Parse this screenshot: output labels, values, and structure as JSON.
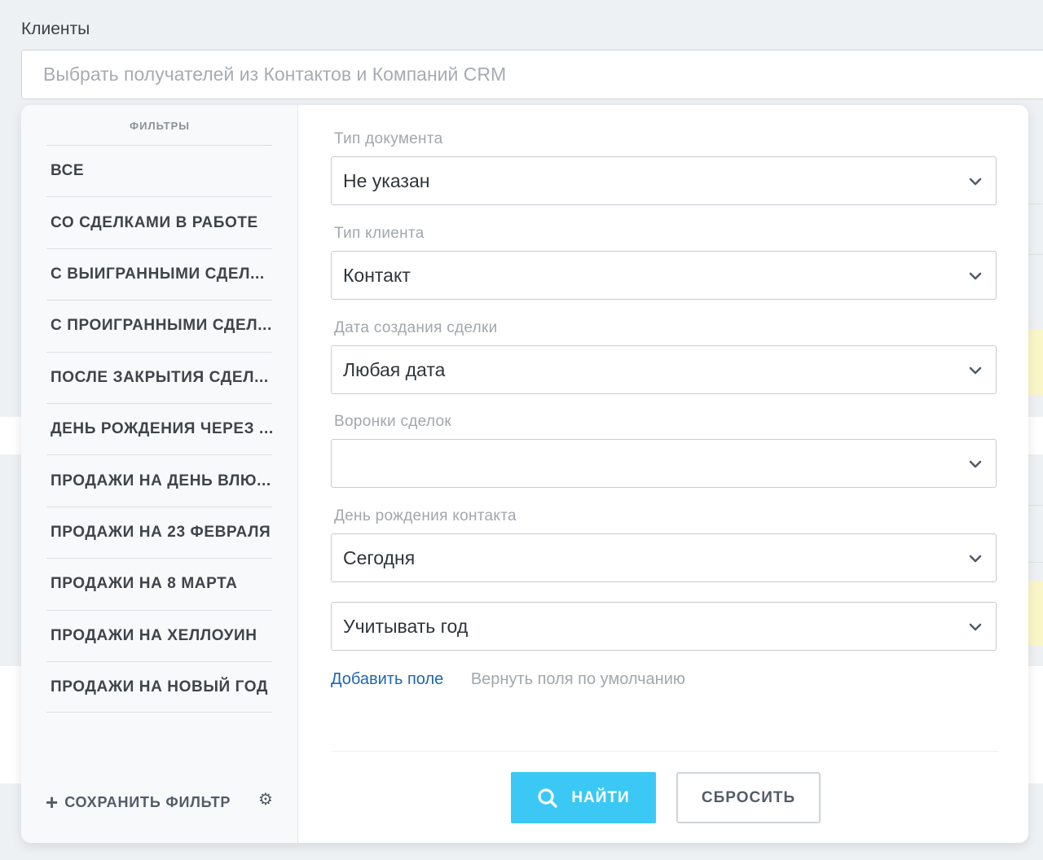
{
  "clients": {
    "label": "Клиенты",
    "placeholder": "Выбрать получателей из Контактов и Компаний CRM"
  },
  "sidebar": {
    "title": "ФИЛЬТРЫ",
    "items": [
      {
        "label": "ВСЕ"
      },
      {
        "label": "СО СДЕЛКАМИ В РАБОТЕ"
      },
      {
        "label": "С ВЫИГРАННЫМИ СДЕЛ..."
      },
      {
        "label": "С ПРОИГРАННЫМИ СДЕЛ..."
      },
      {
        "label": "ПОСЛЕ ЗАКРЫТИЯ СДЕЛ..."
      },
      {
        "label": "ДЕНЬ РОЖДЕНИЯ ЧЕРЕЗ ..."
      },
      {
        "label": "ПРОДАЖИ НА ДЕНЬ ВЛЮ..."
      },
      {
        "label": "ПРОДАЖИ НА 23 ФЕВРАЛЯ"
      },
      {
        "label": "ПРОДАЖИ НА 8 МАРТА"
      },
      {
        "label": "ПРОДАЖИ НА ХЕЛЛОУИН"
      },
      {
        "label": "ПРОДАЖИ НА НОВЫЙ ГОД"
      }
    ],
    "save_filter": "СОХРАНИТЬ ФИЛЬТР",
    "plus_icon": "+",
    "gear_icon": "⚙"
  },
  "form": {
    "fields": [
      {
        "label": "Тип документа",
        "value": "Не указан"
      },
      {
        "label": "Тип клиента",
        "value": "Контакт"
      },
      {
        "label": "Дата создания сделки",
        "value": "Любая дата"
      },
      {
        "label": "Воронки сделок",
        "value": ""
      },
      {
        "label": "День рождения контакта",
        "value": "Сегодня"
      },
      {
        "label": "",
        "value": "Учитывать год"
      }
    ],
    "add_field": "Добавить поле",
    "restore_fields": "Вернуть поля по умолчанию",
    "find_button": "НАЙТИ",
    "reset_button": "СБРОСИТЬ"
  },
  "colors": {
    "accent": "#3bc8f5",
    "link": "#2067b0"
  }
}
